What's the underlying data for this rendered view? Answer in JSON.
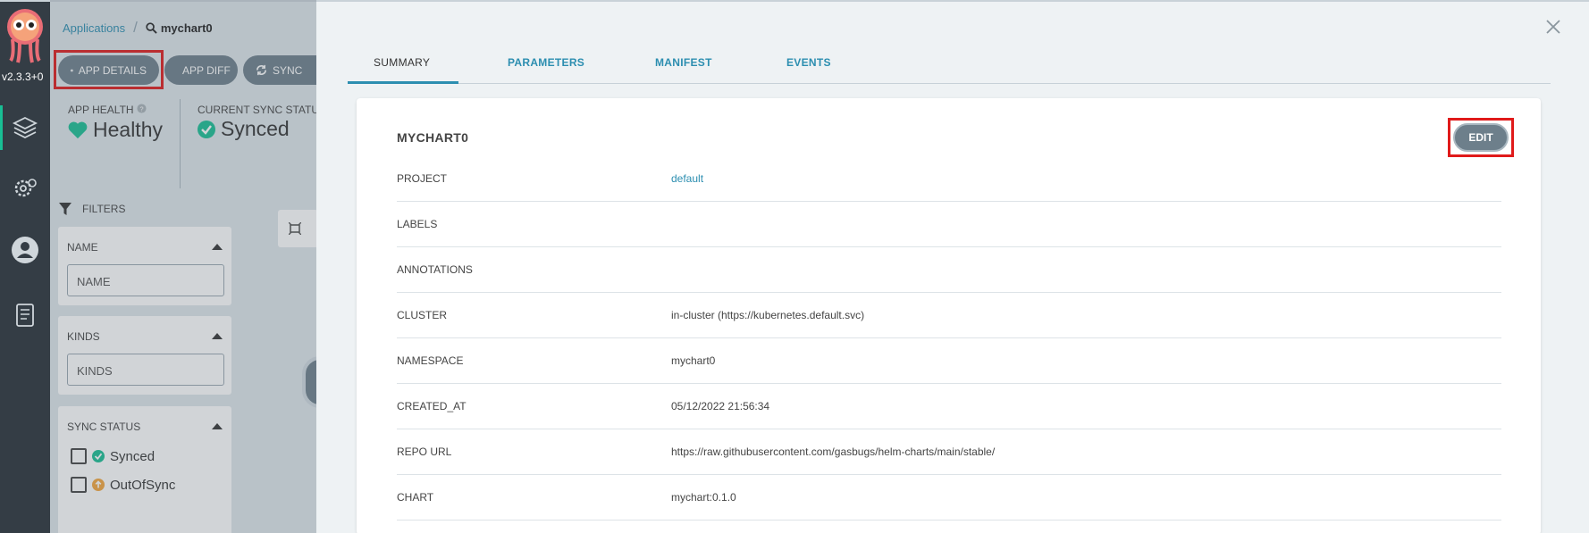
{
  "nav": {
    "version": "v2.3.3+0"
  },
  "breadcrumb": {
    "applications": "Applications",
    "current": "mychart0"
  },
  "toolbar": {
    "app_details": "APP DETAILS",
    "app_diff": "APP DIFF",
    "sync": "SYNC"
  },
  "status": {
    "health_label": "APP HEALTH",
    "health_value": "Healthy",
    "sync_label": "CURRENT SYNC STATUS",
    "sync_value": "Synced"
  },
  "filters": {
    "header": "FILTERS",
    "name_title": "NAME",
    "name_placeholder": "NAME",
    "kinds_title": "KINDS",
    "kinds_placeholder": "KINDS",
    "sync_status_title": "SYNC STATUS",
    "options": [
      "Synced",
      "OutOfSync"
    ]
  },
  "panel": {
    "tabs": [
      "SUMMARY",
      "PARAMETERS",
      "MANIFEST",
      "EVENTS"
    ],
    "active_tab": "SUMMARY",
    "title": "MYCHART0",
    "edit_label": "EDIT",
    "rows": [
      {
        "key": "PROJECT",
        "value": "default"
      },
      {
        "key": "LABELS",
        "value": ""
      },
      {
        "key": "ANNOTATIONS",
        "value": ""
      },
      {
        "key": "CLUSTER",
        "value": "in-cluster (https://kubernetes.default.svc)"
      },
      {
        "key": "NAMESPACE",
        "value": "mychart0"
      },
      {
        "key": "CREATED_AT",
        "value": "05/12/2022 21:56:34"
      },
      {
        "key": "REPO URL",
        "value": "https://raw.githubusercontent.com/gasbugs/helm-charts/main/stable/"
      },
      {
        "key": "CHART",
        "value": "mychart:0.1.0"
      }
    ]
  },
  "colors": {
    "accent": "#2c8eb0",
    "healthy": "#18be94",
    "highlight": "#e01a1a",
    "nav_bg": "#343d45"
  }
}
